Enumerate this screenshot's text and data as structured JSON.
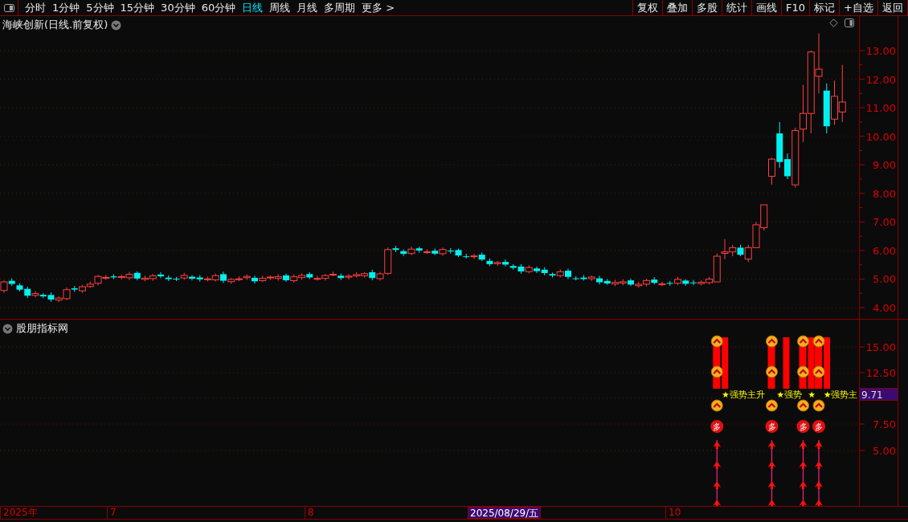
{
  "toolbar": {
    "periods": [
      {
        "label": "分时",
        "selected": false
      },
      {
        "label": "1分钟",
        "selected": false
      },
      {
        "label": "5分钟",
        "selected": false
      },
      {
        "label": "15分钟",
        "selected": false
      },
      {
        "label": "30分钟",
        "selected": false
      },
      {
        "label": "60分钟",
        "selected": false
      },
      {
        "label": "日线",
        "selected": true
      },
      {
        "label": "周线",
        "selected": false
      },
      {
        "label": "月线",
        "selected": false
      },
      {
        "label": "多周期",
        "selected": false
      },
      {
        "label": "更多 >",
        "selected": false
      }
    ],
    "buttons": [
      "复权",
      "叠加",
      "多股",
      "统计",
      "画线",
      "F10",
      "标记",
      "+自选",
      "返回"
    ]
  },
  "price_panel": {
    "title": "海峡创新(日线.前复权)",
    "axis_labels": [
      "13.00",
      "12.00",
      "11.00",
      "10.00",
      "9.00",
      "8.00",
      "7.00",
      "6.00",
      "5.00",
      "4.00"
    ]
  },
  "indicator_panel": {
    "title": "股朋指标网",
    "axis_labels": [
      "15.00",
      "12.50",
      "7.50",
      "5.00"
    ],
    "current_value": "9.71",
    "signals": [
      {
        "badge": "多",
        "label": "★强势主升"
      },
      {
        "badge": "多",
        "label": "★强势"
      },
      {
        "badge": "多",
        "label": "★"
      },
      {
        "badge": "多",
        "label": "★强势主"
      }
    ]
  },
  "date_axis": [
    {
      "label": "2025年",
      "selected": false
    },
    {
      "label": "7",
      "selected": false
    },
    {
      "label": "8",
      "selected": false
    },
    {
      "label": "2025/08/29/五",
      "selected": true
    },
    {
      "label": "10",
      "selected": false
    }
  ]
}
